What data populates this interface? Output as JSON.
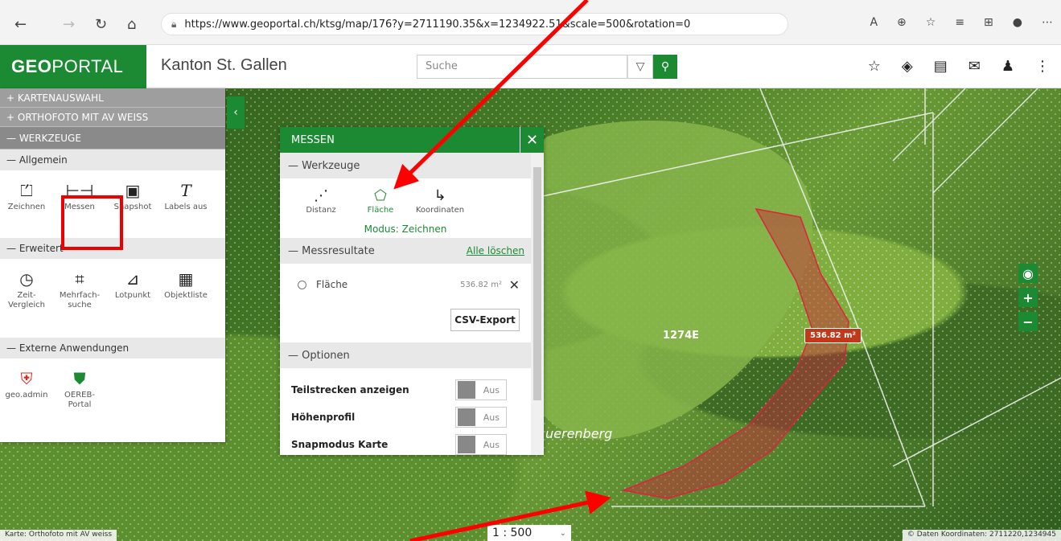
{
  "browser": {
    "url": "https://www.geoportal.ch/ktsg/map/176?y=2711190.35&x=1234922.51&scale=500&rotation=0"
  },
  "header": {
    "logo_bold": "GEO",
    "logo_rest": "PORTAL",
    "title": "Kanton St. Gallen",
    "search_placeholder": "Suche"
  },
  "sidebar": {
    "sections": {
      "kartenauswahl": "+ KARTENAUSWAHL",
      "orthofoto": "+ ORTHOFOTO MIT AV WEISS",
      "werkzeuge": "— WERKZEUGE"
    },
    "allgemein": {
      "title": "— Allgemein",
      "tools": [
        {
          "label": "Zeichnen",
          "icon": "draw-icon"
        },
        {
          "label": "Messen",
          "icon": "measure-icon"
        },
        {
          "label": "Snapshot",
          "icon": "camera-icon"
        },
        {
          "label": "Labels aus",
          "icon": "text-icon"
        }
      ]
    },
    "erweitert": {
      "title": "— Erweitert",
      "tools": [
        {
          "label": "Zeit-\nVergleich",
          "icon": "clock-icon"
        },
        {
          "label": "Mehrfach-\nsuche",
          "icon": "multi-search-icon"
        },
        {
          "label": "Lotpunkt",
          "icon": "perpendicular-icon"
        },
        {
          "label": "Objektliste",
          "icon": "object-list-icon"
        }
      ]
    },
    "extern": {
      "title": "— Externe Anwendungen",
      "tools": [
        {
          "label": "geo.admin",
          "icon": "swiss-shield-icon"
        },
        {
          "label": "OEREB-\nPortal",
          "icon": "sg-shield-icon"
        }
      ]
    }
  },
  "dialog": {
    "title": "MESSEN",
    "werkzeuge_title": "— Werkzeuge",
    "tools": [
      {
        "label": "Distanz"
      },
      {
        "label": "Fläche"
      },
      {
        "label": "Koordinaten"
      }
    ],
    "modus": "Modus: Zeichnen",
    "results_title": "— Messresultate",
    "clear_all": "Alle löschen",
    "result_name": "Fläche",
    "result_value": "536.82 m²",
    "csv_button": "CSV-Export",
    "optionen_title": "— Optionen",
    "options": [
      {
        "label": "Teilstrecken anzeigen",
        "state": "Aus"
      },
      {
        "label": "Höhenprofil",
        "state": "Aus"
      },
      {
        "label": "Snapmodus Karte",
        "state": "Aus"
      }
    ]
  },
  "map": {
    "parcel_label": "1274E",
    "place_label": "uerenberg",
    "area_badge": "536.82 m²",
    "scale": "1 : 500",
    "footer_left": "Karte: Orthofoto mit AV weiss",
    "footer_right": "© Daten  Koordinaten: 2711220,1234945"
  },
  "colors": {
    "brand": "#1b8a32",
    "polygon": "#d0213a",
    "annotation": "#ff0000"
  }
}
